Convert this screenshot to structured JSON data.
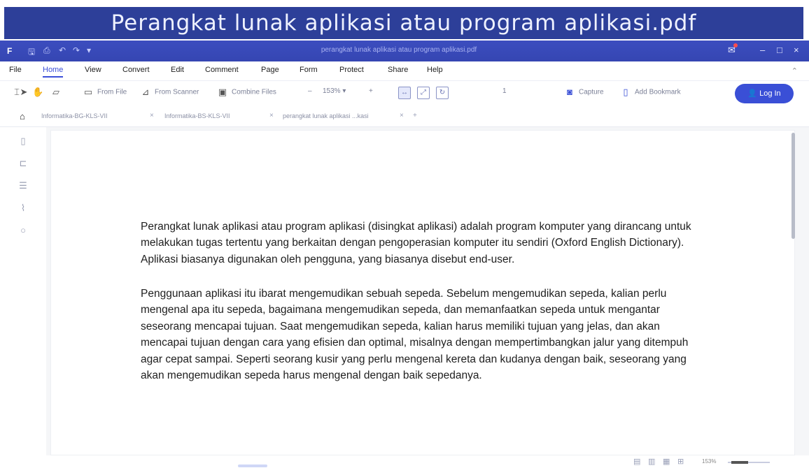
{
  "banner": {
    "title": "Perangkat lunak aplikasi atau program aplikasi.pdf"
  },
  "window": {
    "title": "perangkat lunak aplikasi atau program aplikasi.pdf",
    "controls": [
      "–",
      "□",
      "×"
    ]
  },
  "menu": {
    "items": [
      "File",
      "Home",
      "View",
      "Convert",
      "Edit",
      "Comment",
      "Page",
      "Form",
      "Protect",
      "Share",
      "Help"
    ],
    "active": "Home"
  },
  "toolbar": {
    "from_file": "From File",
    "from_scanner": "From Scanner",
    "combine_files": "Combine Files",
    "zoom_out": "–",
    "zoom_value": "153%",
    "zoom_in": "+",
    "page_number": "1",
    "capture": "Capture",
    "add_bookmark": "Add Bookmark",
    "login": "Log In"
  },
  "tabs": [
    {
      "label": "Informatika-BG-KLS-VII",
      "close": "×"
    },
    {
      "label": "Informatika-BS-KLS-VII",
      "close": "×"
    },
    {
      "label": "perangkat lunak aplikasi ...kasi",
      "close": "×"
    }
  ],
  "tab_add": "+",
  "document": {
    "paragraph1": "Perangkat lunak aplikasi atau program aplikasi (disingkat aplikasi) adalah program komputer yang dirancang untuk melakukan tugas tertentu yang berkaitan dengan pengoperasian komputer itu sendiri (Oxford English Dictionary). Aplikasi biasanya digunakan oleh pengguna, yang biasanya disebut end-user.",
    "paragraph2": "Penggunaan aplikasi itu ibarat mengemudikan sebuah sepeda. Sebelum mengemudikan sepeda, kalian perlu mengenal apa itu sepeda, bagaimana mengemudikan sepeda, dan memanfaatkan sepeda untuk mengantar seseorang mencapai tujuan. Saat mengemudikan sepeda, kalian harus memiliki tujuan yang jelas, dan akan mencapai tujuan dengan cara yang efisien dan optimal, misalnya dengan mempertimbangkan jalur yang ditempuh agar cepat sampai. Seperti seorang kusir yang perlu mengenal kereta dan kudanya dengan baik, seseorang yang akan mengemudikan sepeda harus mengenal dengan baik sepedanya."
  },
  "status": {
    "zoom": "153%"
  },
  "colors": {
    "banner": "#2d3f99",
    "titlebar": "#3c4dbf",
    "accent": "#3a4fd6"
  }
}
